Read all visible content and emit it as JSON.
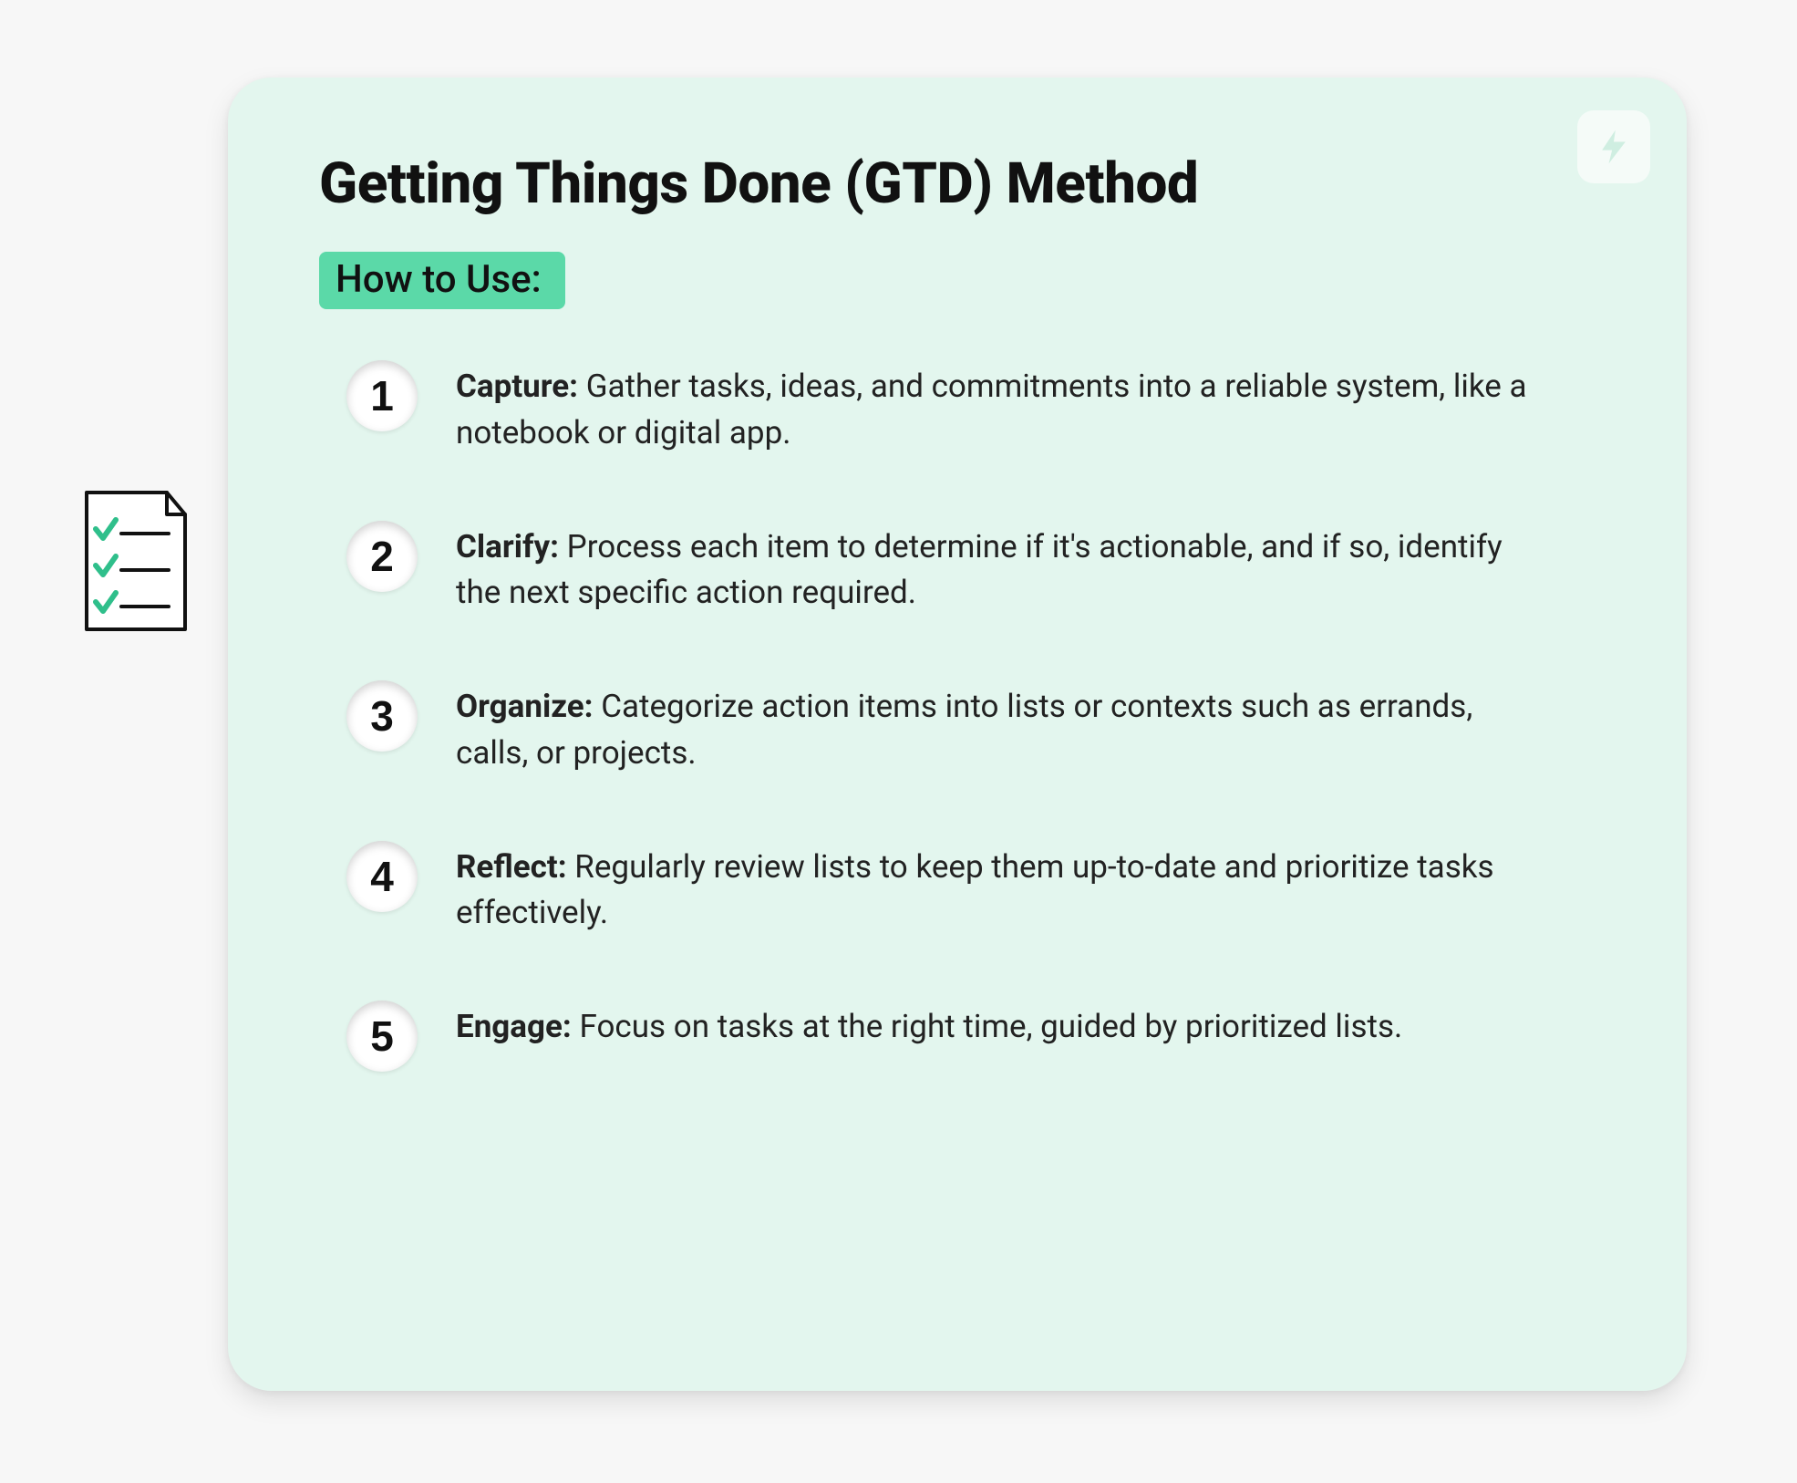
{
  "colors": {
    "cardBg": "#e3f6ee",
    "accent": "#5bd9a8",
    "pageBg": "#f7f7f7",
    "checkGreen": "#2fbf8b"
  },
  "title": "Getting Things Done (GTD) Method",
  "subtitle": "How to Use:",
  "badgeIcon": "lightning-icon",
  "sideIcon": "checklist-icon",
  "steps": [
    {
      "num": "1",
      "label": "Capture:",
      "text": " Gather tasks, ideas, and commitments into a reliable system, like a notebook or digital app."
    },
    {
      "num": "2",
      "label": "Clarify:",
      "text": " Process each item to determine if it's actionable, and if so, identify the next specific action required."
    },
    {
      "num": "3",
      "label": "Organize:",
      "text": " Categorize action items into lists or contexts such as errands, calls, or projects."
    },
    {
      "num": "4",
      "label": "Reflect:",
      "text": " Regularly review lists to keep them up-to-date and prioritize tasks effectively."
    },
    {
      "num": "5",
      "label": "Engage:",
      "text": " Focus on tasks at the right time, guided by prioritized lists."
    }
  ]
}
